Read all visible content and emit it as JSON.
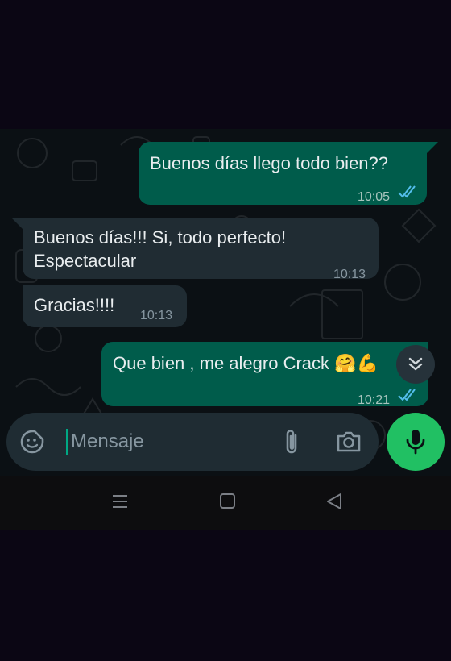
{
  "messages": [
    {
      "direction": "out",
      "text": "Buenos días llego todo bien??",
      "time": "10:05",
      "status": "read"
    },
    {
      "direction": "in",
      "text": "Buenos días!!! Si, todo perfecto!\nEspectacular",
      "time": "10:13"
    },
    {
      "direction": "in",
      "text": "Gracias!!!!",
      "time": "10:13"
    },
    {
      "direction": "out",
      "text": "Que bien , me alegro Crack 🤗💪",
      "time": "10:21",
      "status": "read"
    }
  ],
  "composer": {
    "placeholder": "Mensaje",
    "icons": [
      "sticker-icon",
      "attach-icon",
      "camera-icon",
      "mic-icon"
    ]
  },
  "scroll_button": {
    "icon": "double-chevron-down-icon"
  },
  "system_nav": {
    "icons": [
      "recents-icon",
      "home-icon",
      "back-icon"
    ]
  },
  "colors": {
    "outgoing_bubble": "#005c4b",
    "incoming_bubble": "#202c33",
    "accent": "#21c063",
    "read_ticks": "#53bdeb"
  }
}
